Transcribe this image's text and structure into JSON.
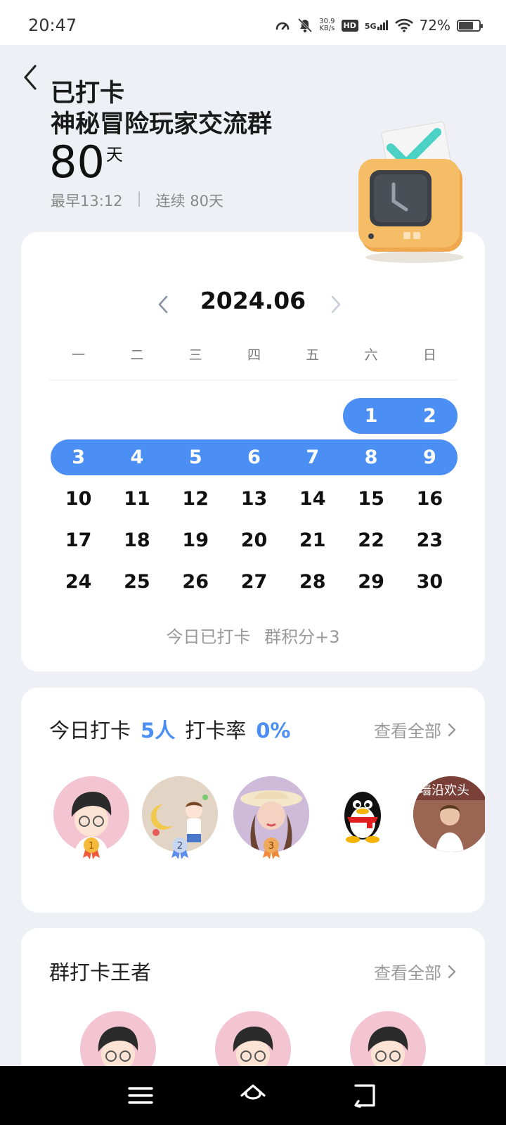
{
  "status_bar": {
    "time": "20:47",
    "net_speed_value": "30.9",
    "net_speed_unit": "KB/s",
    "hd": "HD",
    "network": "5G",
    "battery_text": "72%",
    "battery_level": 0.72,
    "icons": [
      "speed-meter-icon",
      "mute-bell-icon",
      "signal-bars-icon",
      "wifi-icon",
      "battery-icon"
    ]
  },
  "header": {
    "title_line1": "已打卡",
    "title_line2": "神秘冒险玩家交流群",
    "days_count": "80",
    "days_unit": "天",
    "earliest": "最早13:12",
    "separator": "|",
    "streak": "连续 80天"
  },
  "calendar": {
    "month": "2024.06",
    "weekdays": [
      "一",
      "二",
      "三",
      "四",
      "五",
      "六",
      "日"
    ],
    "first_weekday_index": 5,
    "days_in_month": 30,
    "checked_days": [
      1,
      2,
      3,
      4,
      5,
      6,
      7,
      8,
      9
    ],
    "today_status": "今日已打卡",
    "points": "群积分+3"
  },
  "checkin_today": {
    "label": "今日打卡",
    "count": "5人",
    "rate_label": "打卡率",
    "rate": "0%",
    "see_all": "查看全部",
    "medals": [
      "1",
      "2",
      "3"
    ],
    "avatar_banner_text": "墙沿欢头"
  },
  "kings": {
    "title": "群打卡王者",
    "see_all": "查看全部"
  },
  "colors": {
    "accent": "#4b8ff5",
    "background": "#eef0f5",
    "card": "#ffffff",
    "navbar": "#000000"
  }
}
